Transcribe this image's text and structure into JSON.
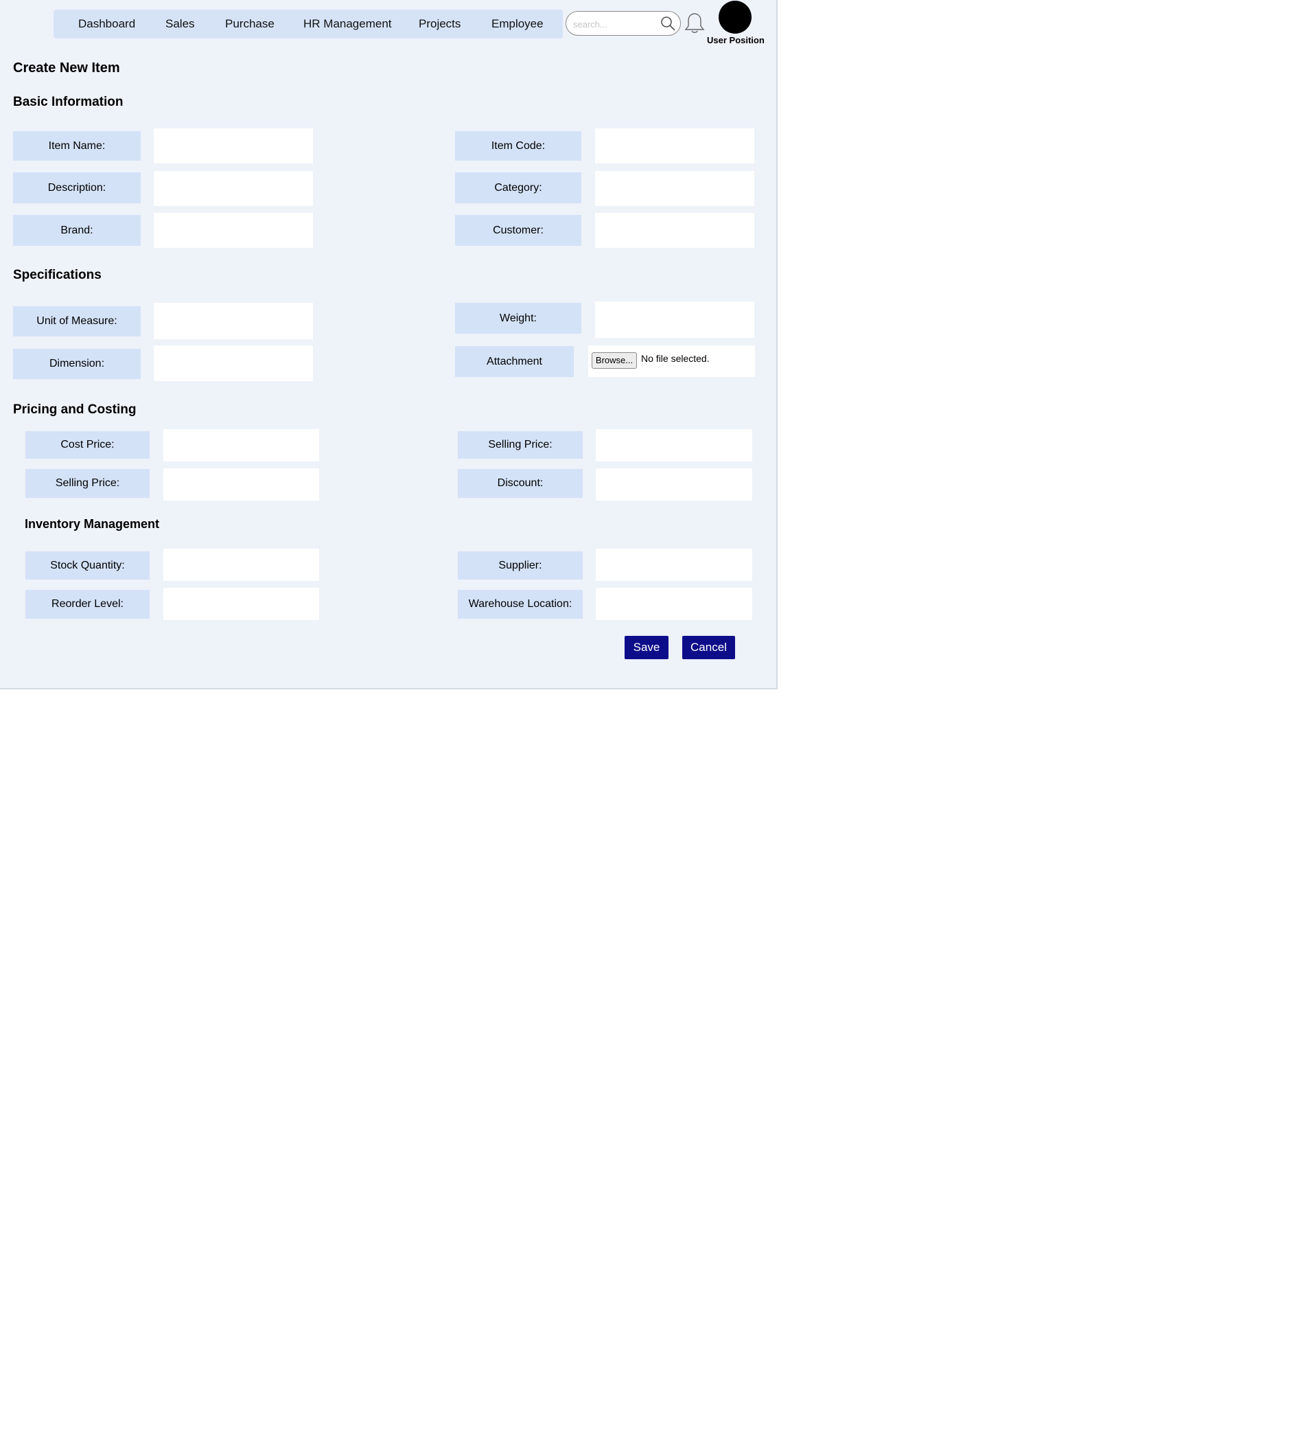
{
  "nav": {
    "items": [
      "Dashboard",
      "Sales",
      "Purchase",
      "HR Management",
      "Projects",
      "Employee"
    ]
  },
  "header": {
    "search_placeholder": "search...",
    "search_icon": "search-icon",
    "notification_icon": "bell-icon",
    "user_position": "User Position"
  },
  "page": {
    "title": "Create New Item"
  },
  "sections": {
    "basic": {
      "title": "Basic Information",
      "item_name": "Item Name:",
      "item_code": "Item Code:",
      "description": "Description:",
      "category": "Category:",
      "brand": "Brand:",
      "customer": "Customer:"
    },
    "specs": {
      "title": "Specifications",
      "unit_of_measure": "Unit of Measure:",
      "weight": "Weight:",
      "dimension": "Dimension:",
      "attachment": "Attachment",
      "browse_label": "Browse...",
      "file_status": "No file selected."
    },
    "pricing": {
      "title": "Pricing and Costing",
      "cost_price": "Cost Price:",
      "selling_price_right": "Selling Price:",
      "selling_price_left": "Selling Price:",
      "discount": "Discount:"
    },
    "inventory": {
      "title": "Inventory Management",
      "stock_quantity": "Stock Quantity:",
      "supplier": "Supplier:",
      "reorder_level": "Reorder Level:",
      "warehouse_location": "Warehouse Location:"
    }
  },
  "actions": {
    "save": "Save",
    "cancel": "Cancel"
  },
  "colors": {
    "page_bg": "#eef2f9",
    "nav_bg": "#d6e3f6",
    "label_bg": "#d4e2f7",
    "primary_button": "#0d0d8a"
  }
}
